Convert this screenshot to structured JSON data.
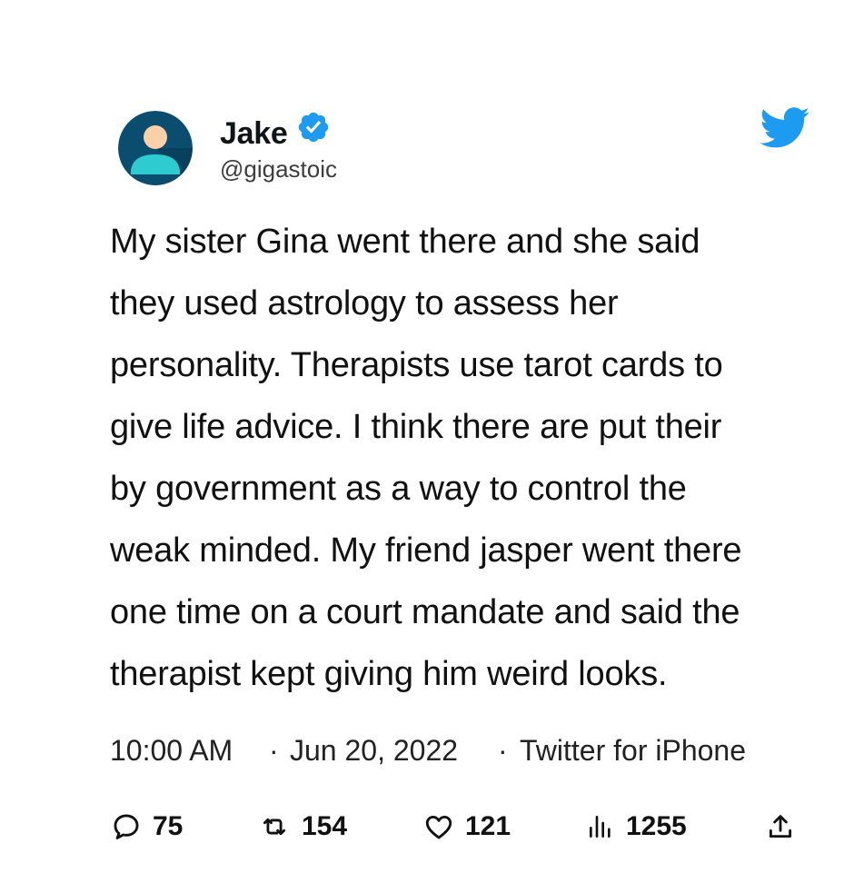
{
  "user": {
    "display_name": "Jake",
    "handle": "@gigastoic",
    "verified": true,
    "avatar_icon": "default-avatar-icon"
  },
  "brand_icon": "twitter-bird-icon",
  "tweet": {
    "text_lines": [
      "My sister Gina went there and she said",
      "they used astrology to assess her",
      "personality. Therapists use tarot cards to",
      "give life advice. I think there are put their",
      "by government as a way to control the",
      "weak minded. My friend jasper went there",
      "one time on a court mandate and said the",
      "therapist kept giving him weird looks."
    ],
    "time": "10:00 AM",
    "date": "Jun 20, 2022",
    "source": "Twitter for iPhone",
    "separator": "·"
  },
  "actions": {
    "replies": "75",
    "retweets": "154",
    "likes": "121",
    "views": "1255"
  },
  "colors": {
    "verified_blue": "#1d9bf0",
    "twitter_blue": "#1d9bf0",
    "avatar_bg": "#0b4d6e",
    "avatar_skin": "#f9d0a8",
    "avatar_shirt": "#2ecbd1"
  }
}
